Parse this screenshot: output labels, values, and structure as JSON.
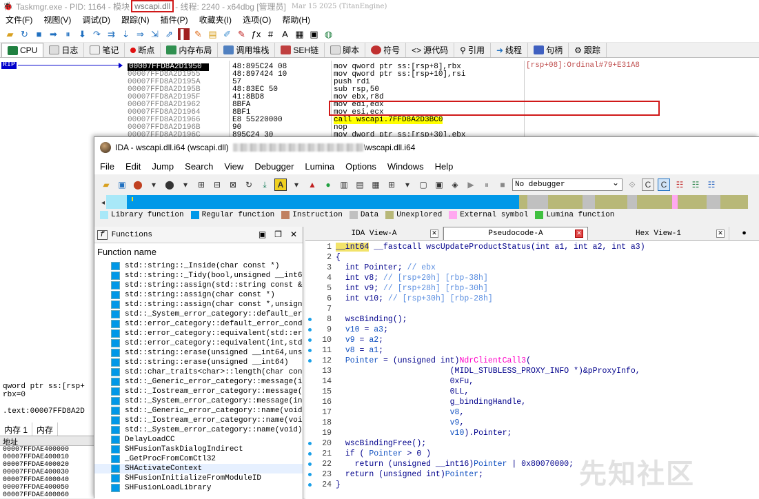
{
  "x64dbg": {
    "title_prefix": "Taskmgr.exe - PID: 1164 - 模块",
    "title_module": "wscapi.dll",
    "title_suffix": "- 线程: 2240 - x64dbg [管理员]",
    "title_sig": "Mar 15 2025 (TitanEngine)",
    "menu": [
      "文件(F)",
      "视图(V)",
      "调试(D)",
      "跟踪(N)",
      "插件(P)",
      "收藏夹(I)",
      "选项(O)",
      "帮助(H)"
    ],
    "tabs": [
      "CPU",
      "日志",
      "笔记",
      "断点",
      "内存布局",
      "调用堆栈",
      "SEH链",
      "脚本",
      "符号",
      "源代码",
      "引用",
      "线程",
      "句柄",
      "跟踪"
    ],
    "rip_label": "RIP",
    "disasm": [
      {
        "addr": "00007FFD8A2D1950",
        "bytes": "48:895C24 08",
        "ins": "mov qword ptr ss:[rsp+8],rbx",
        "current": true
      },
      {
        "addr": "00007FFD8A2D1955",
        "bytes": "48:897424 10",
        "ins": "mov qword ptr ss:[rsp+10],rsi"
      },
      {
        "addr": "00007FFD8A2D195A",
        "bytes": "57",
        "ins": "push rdi"
      },
      {
        "addr": "00007FFD8A2D195B",
        "bytes": "48:83EC 50",
        "ins": "sub rsp,50"
      },
      {
        "addr": "00007FFD8A2D195F",
        "bytes": "41:8BD8",
        "ins": "mov ebx,r8d"
      },
      {
        "addr": "00007FFD8A2D1962",
        "bytes": "8BFA",
        "ins": "mov edi,edx"
      },
      {
        "addr": "00007FFD8A2D1964",
        "bytes": "8BF1",
        "ins": "mov esi,ecx"
      },
      {
        "addr": "00007FFD8A2D1966",
        "bytes": "E8 55220000",
        "ins": "call wscapi.7FFD8A2D3BC0",
        "call": true
      },
      {
        "addr": "00007FFD8A2D196B",
        "bytes": "90",
        "ins": "nop"
      },
      {
        "addr": "00007FFD8A2D196C",
        "bytes": "895C24 30",
        "ins": "mov dword ptr ss:[rsp+30],ebx"
      }
    ],
    "comment": "[rsp+08]:Ordinal#79+E31A8",
    "info_lines": [
      "qword ptr ss:[rsp+",
      "rbx=0",
      "",
      ".text:00007FFD8A2D"
    ],
    "mem_tabs": [
      "内存 1",
      "内存"
    ],
    "mem_header": "地址",
    "mem_rows": [
      "00007FFDAE400000",
      "00007FFDAE400010",
      "00007FFDAE400020",
      "00007FFDAE400030",
      "00007FFDAE400040",
      "00007FFDAE400050",
      "00007FFDAE400060"
    ]
  },
  "ida": {
    "title": "IDA - wscapi.dll.i64 (wscapi.dll)",
    "title_path_suffix": "\\wscapi.dll.i64",
    "menu": [
      "File",
      "Edit",
      "Jump",
      "Search",
      "View",
      "Debugger",
      "Lumina",
      "Options",
      "Windows",
      "Help"
    ],
    "debugger_select": "No debugger",
    "legend": [
      {
        "label": "Library function",
        "color": "#a8e8f8"
      },
      {
        "label": "Regular function",
        "color": "#0098e8"
      },
      {
        "label": "Instruction",
        "color": "#c08060"
      },
      {
        "label": "Data",
        "color": "#c0c0c0"
      },
      {
        "label": "Unexplored",
        "color": "#b8b878"
      },
      {
        "label": "External symbol",
        "color": "#ffa8f0"
      },
      {
        "label": "Lumina function",
        "color": "#40c040"
      }
    ],
    "functions_title": "Functions",
    "function_column": "Function name",
    "functions": [
      "std::string::_Inside(char const *)",
      "std::string::_Tidy(bool,unsigned __int64)",
      "std::string::assign(std::string const &,u",
      "std::string::assign(char const *)",
      "std::string::assign(char const *,unsigne",
      "std::_System_error_category::default_err",
      "std::error_category::default_error_condi",
      "std::error_category::equivalent(std::err",
      "std::error_category::equivalent(int,std:",
      "std::string::erase(unsigned __int64,unsi",
      "std::string::erase(unsigned __int64)",
      "std::char_traits<char>::length(char cons",
      "std::_Generic_error_category::message(in",
      "std::_Iostream_error_category::message(i",
      "std::_System_error_category::message(int",
      "std::_Generic_error_category::name(void)",
      "std::_Iostream_error_category::name(void",
      "std::_System_error_category::name(void)",
      "DelayLoadCC",
      "SHFusionTaskDialogIndirect",
      "_GetProcFromComCtl32",
      "SHActivateContext",
      "SHFusionInitializeFromModuleID",
      "SHFusionLoadLibrary"
    ],
    "tabs": [
      "IDA View-A",
      "Pseudocode-A",
      "Hex View-1"
    ],
    "code": [
      {
        "n": "1",
        "dot": false,
        "html": "<span class=\"kw\" style=\"background:#f2e36a\">__int64</span> <span class=\"kw\">__fastcall</span> <span class=\"kw\">wscUpdateProductStatus</span><span class=\"kw\">(int a1, int a2, int a3)</span>"
      },
      {
        "n": "2",
        "dot": false,
        "html": "<span class=\"kw\">{</span>"
      },
      {
        "n": "3",
        "dot": false,
        "html": "  <span class=\"kw\">int Pointer;</span> <span class=\"cm\">// ebx</span>"
      },
      {
        "n": "4",
        "dot": false,
        "html": "  <span class=\"kw\">int v8;</span> <span class=\"cm\">// [rsp+20h] [rbp-38h]</span>"
      },
      {
        "n": "5",
        "dot": false,
        "html": "  <span class=\"kw\">int v9;</span> <span class=\"cm\">// [rsp+28h] [rbp-30h]</span>"
      },
      {
        "n": "6",
        "dot": false,
        "html": "  <span class=\"kw\">int v10;</span> <span class=\"cm\">// [rsp+30h] [rbp-28h]</span>"
      },
      {
        "n": "7",
        "dot": false,
        "html": ""
      },
      {
        "n": "8",
        "dot": true,
        "html": "  <span class=\"kw\">wscBinding();</span>"
      },
      {
        "n": "9",
        "dot": true,
        "html": "  <span class=\"vr\">v10</span> <span class=\"kw\">=</span> <span class=\"vr\">a3</span><span class=\"kw\">;</span>"
      },
      {
        "n": "10",
        "dot": true,
        "html": "  <span class=\"vr\">v9</span> <span class=\"kw\">=</span> <span class=\"vr\">a2</span><span class=\"kw\">;</span>"
      },
      {
        "n": "11",
        "dot": true,
        "html": "  <span class=\"vr\">v8</span> <span class=\"kw\">=</span> <span class=\"vr\">a1</span><span class=\"kw\">;</span>"
      },
      {
        "n": "12",
        "dot": true,
        "html": "  <span class=\"vr\">Pointer</span> <span class=\"kw\">= (unsigned int)</span><span class=\"fn\">NdrClientCall3</span><span class=\"kw\">(</span>"
      },
      {
        "n": "13",
        "dot": false,
        "html": "                        <span class=\"kw\">(MIDL_STUBLESS_PROXY_INFO *)&amp;pProxyInfo,</span>"
      },
      {
        "n": "14",
        "dot": false,
        "html": "                        <span class=\"kw\">0xFu,</span>"
      },
      {
        "n": "15",
        "dot": false,
        "html": "                        <span class=\"kw\">0LL,</span>"
      },
      {
        "n": "16",
        "dot": false,
        "html": "                        <span class=\"kw\">g_bindingHandle,</span>"
      },
      {
        "n": "17",
        "dot": false,
        "html": "                        <span class=\"vr\">v8</span><span class=\"kw\">,</span>"
      },
      {
        "n": "18",
        "dot": false,
        "html": "                        <span class=\"vr\">v9</span><span class=\"kw\">,</span>"
      },
      {
        "n": "19",
        "dot": false,
        "html": "                        <span class=\"vr\">v10</span><span class=\"kw\">).Pointer;</span>"
      },
      {
        "n": "20",
        "dot": true,
        "html": "  <span class=\"kw\">wscBindingFree();</span>"
      },
      {
        "n": "21",
        "dot": true,
        "html": "  <span class=\"kw\">if (</span> <span class=\"vr\">Pointer</span> <span class=\"kw\">&gt; 0 )</span>"
      },
      {
        "n": "22",
        "dot": true,
        "html": "    <span class=\"kw\">return (unsigned __int16)</span><span class=\"vr\">Pointer</span> <span class=\"kw\">| 0x80070000;</span>"
      },
      {
        "n": "23",
        "dot": true,
        "html": "  <span class=\"kw\">return (unsigned int)</span><span class=\"vr\">Pointer</span><span class=\"kw\">;</span>"
      },
      {
        "n": "24",
        "dot": true,
        "html": "<span class=\"kw\">}</span>"
      }
    ]
  },
  "watermark": "先知社区"
}
